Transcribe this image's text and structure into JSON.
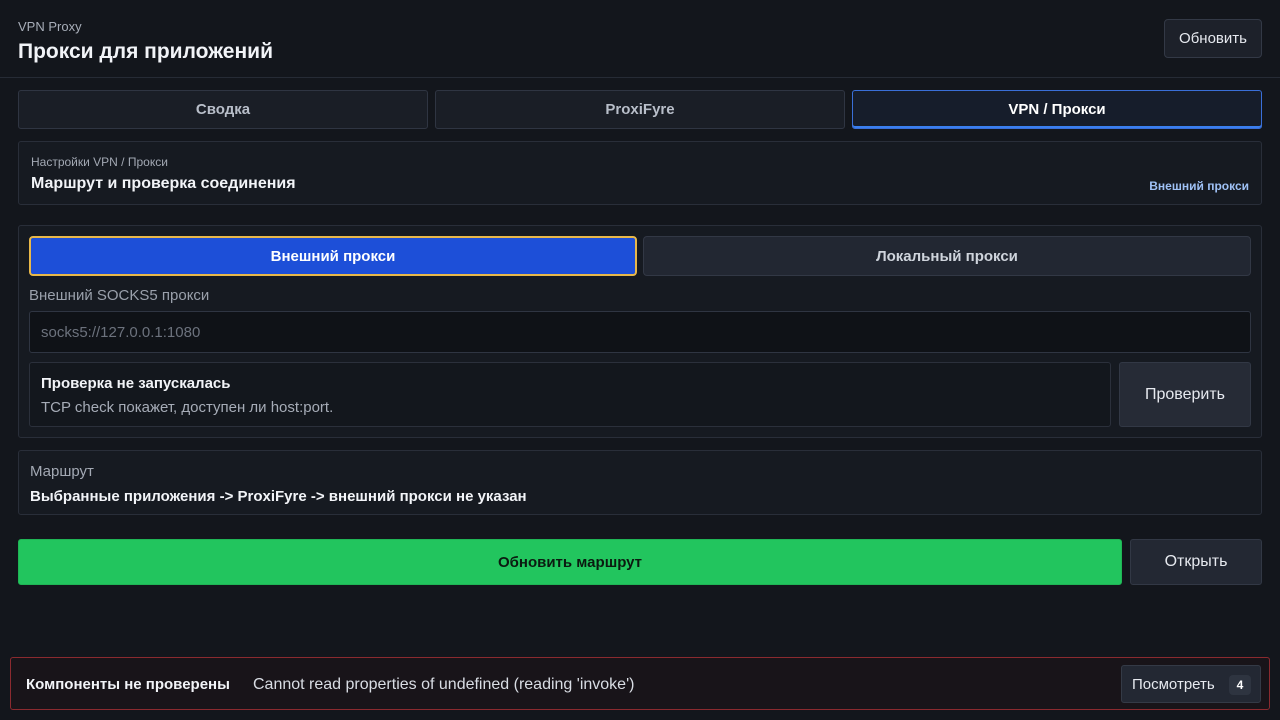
{
  "header": {
    "app_name": "VPN Proxy",
    "title": "Прокси для приложений",
    "refresh_label": "Обновить"
  },
  "tabs": [
    {
      "label": "Сводка",
      "active": false
    },
    {
      "label": "ProxiFyre",
      "active": false
    },
    {
      "label": "VPN / Прокси",
      "active": true
    }
  ],
  "section": {
    "subtitle": "Настройки VPN / Прокси",
    "title": "Маршрут и проверка соединения",
    "mode_badge": "Внешний прокси"
  },
  "proxy": {
    "modes": [
      {
        "label": "Внешний прокси",
        "selected": true
      },
      {
        "label": "Локальный прокси",
        "selected": false
      }
    ],
    "field_label": "Внешний SOCKS5 прокси",
    "input_value": "",
    "input_placeholder": "socks5://127.0.0.1:1080",
    "check": {
      "title": "Проверка не запускалась",
      "description": "TCP check покажет, доступен ли host:port.",
      "button_label": "Проверить"
    }
  },
  "route": {
    "label": "Маршрут",
    "value": "Выбранные приложения -> ProxiFyre -> внешний прокси не указан"
  },
  "actions": {
    "update_route_label": "Обновить маршрут",
    "open_label": "Открыть"
  },
  "status": {
    "title": "Компоненты не проверены",
    "message": "Cannot read properties of undefined (reading 'invoke')",
    "view_label": "Посмотреть",
    "count": "4"
  },
  "colors": {
    "background": "#13161c",
    "accent_blue": "#1d4fd8",
    "selected_outline": "#e8b84a",
    "success_green": "#22c55e",
    "error_border": "#8b2a2f"
  }
}
